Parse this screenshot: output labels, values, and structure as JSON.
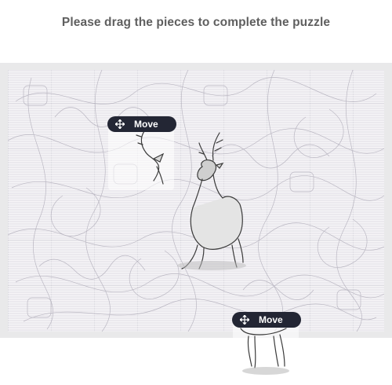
{
  "prompt": "Please drag the pieces to complete the puzzle",
  "pieces": [
    {
      "handle_label": "Move",
      "icon": "move-icon"
    },
    {
      "handle_label": "Move",
      "icon": "move-icon"
    }
  ],
  "colors": {
    "handle_bg": "#232634",
    "handle_text": "#ffffff",
    "prompt_text": "#5f5f5f",
    "board_bg": "#e9e9ea"
  }
}
